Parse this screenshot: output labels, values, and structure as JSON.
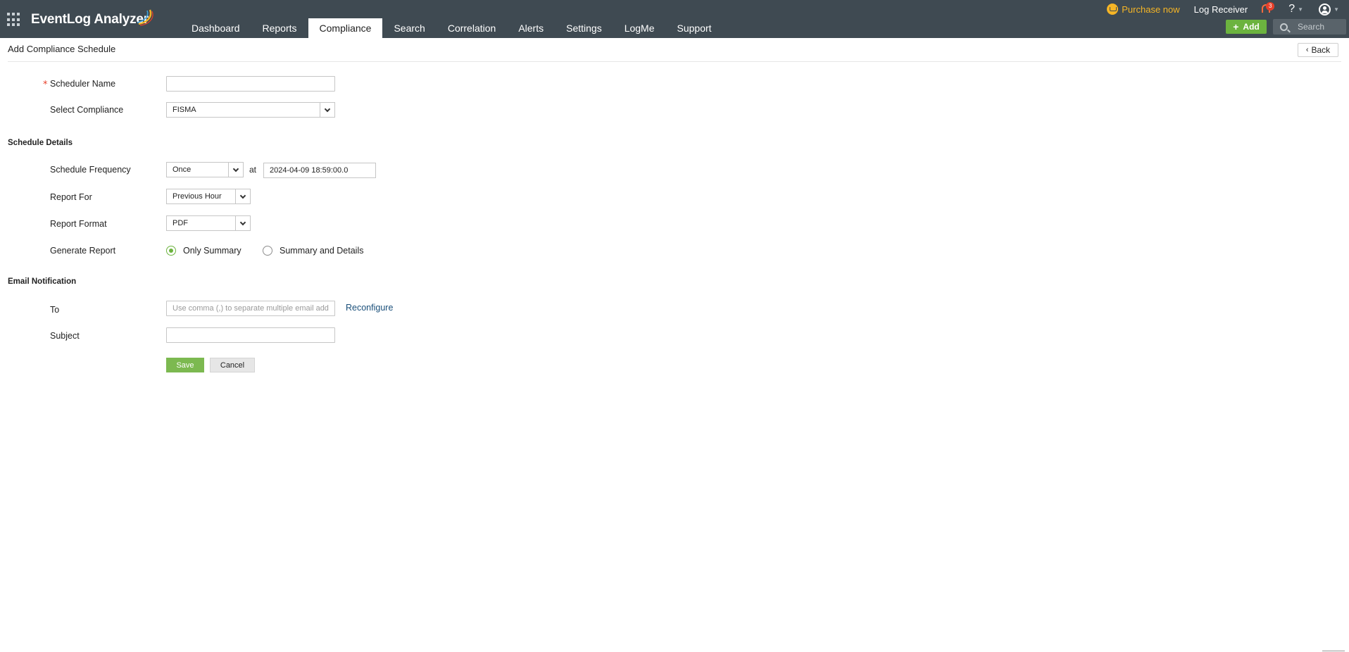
{
  "app": {
    "name": "EventLog Analyzer"
  },
  "nav": {
    "tabs": [
      {
        "label": "Dashboard",
        "active": false
      },
      {
        "label": "Reports",
        "active": false
      },
      {
        "label": "Compliance",
        "active": true
      },
      {
        "label": "Search",
        "active": false
      },
      {
        "label": "Correlation",
        "active": false
      },
      {
        "label": "Alerts",
        "active": false
      },
      {
        "label": "Settings",
        "active": false
      },
      {
        "label": "LogMe",
        "active": false
      },
      {
        "label": "Support",
        "active": false
      }
    ]
  },
  "topright": {
    "purchase_label": "Purchase now",
    "log_receiver_label": "Log Receiver",
    "notification_count": "3",
    "help_label": "?",
    "add_label": "Add",
    "search_placeholder": "Search"
  },
  "page": {
    "title": "Add Compliance Schedule",
    "back_label": "Back"
  },
  "form": {
    "scheduler_name": {
      "label": "Scheduler Name",
      "required_mark": "*",
      "value": ""
    },
    "select_compliance": {
      "label": "Select Compliance",
      "value": "FISMA"
    },
    "schedule_details_title": "Schedule Details",
    "schedule_frequency": {
      "label": "Schedule Frequency",
      "value": "Once",
      "at_label": "at",
      "datetime": "2024-04-09 18:59:00.0"
    },
    "report_for": {
      "label": "Report For",
      "value": "Previous Hour"
    },
    "report_format": {
      "label": "Report Format",
      "value": "PDF"
    },
    "generate_report": {
      "label": "Generate Report",
      "options": [
        {
          "label": "Only Summary",
          "selected": true
        },
        {
          "label": "Summary and Details",
          "selected": false
        }
      ]
    },
    "email_notification_title": "Email Notification",
    "to": {
      "label": "To",
      "placeholder": "Use comma (,) to separate multiple email addresses",
      "reconfigure_label": "Reconfigure"
    },
    "subject": {
      "label": "Subject",
      "value": ""
    },
    "save_label": "Save",
    "cancel_label": "Cancel"
  },
  "colors": {
    "topbar": "#3f4a52",
    "accent_green": "#6cb33f",
    "purchase_yellow": "#f5b526",
    "link_blue": "#1a4f7a"
  }
}
